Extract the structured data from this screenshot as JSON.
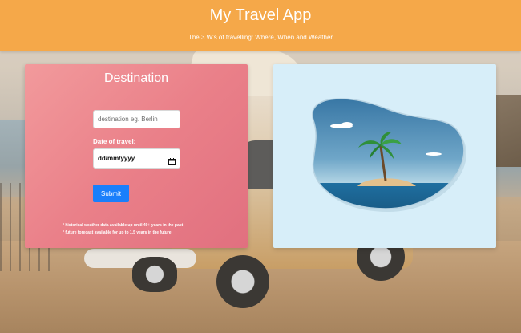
{
  "header": {
    "title": "My Travel App",
    "subtitle": "The 3 W's of travelling: Where, When and Weather"
  },
  "form": {
    "heading": "Destination",
    "destination_placeholder": "destination eg. Berlin",
    "date_label": "Date of travel:",
    "date_value": "dd/mm/yyyy",
    "submit_label": "Submit",
    "notes": [
      "* historical weather data available up until 40+ years in the past",
      "* future forecast available for up to 1.5 years in the future"
    ]
  },
  "icons": {
    "calendar": "calendar-icon",
    "illustration": "island-palm-illustration"
  },
  "colors": {
    "header_bg": "#f5a849",
    "card_pink": "#ea8089",
    "button_blue": "#1a7ffb",
    "illustration_bg": "#d7eef9"
  }
}
